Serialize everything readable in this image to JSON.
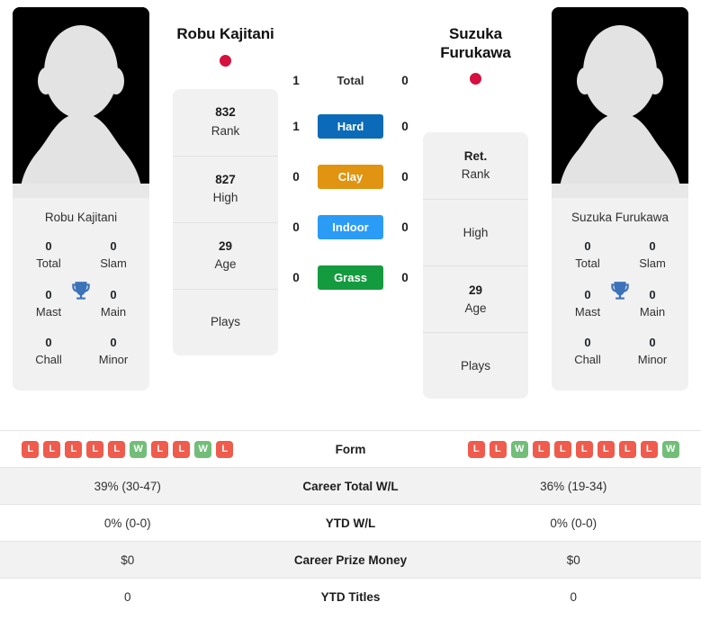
{
  "players": {
    "left": {
      "name": "Robu Kajitani",
      "card_name": "Robu Kajitani",
      "flag_color": "#d4113f",
      "titles": [
        {
          "value": "0",
          "label": "Total"
        },
        {
          "value": "0",
          "label": "Slam"
        },
        {
          "value": "0",
          "label": "Mast"
        },
        {
          "value": "0",
          "label": "Main"
        },
        {
          "value": "0",
          "label": "Chall"
        },
        {
          "value": "0",
          "label": "Minor"
        }
      ],
      "rank_rows": [
        {
          "value": "832",
          "label": "Rank"
        },
        {
          "value": "827",
          "label": "High"
        },
        {
          "value": "29",
          "label": "Age"
        },
        {
          "value": "",
          "label": "Plays"
        }
      ],
      "form": [
        "L",
        "L",
        "L",
        "L",
        "L",
        "W",
        "L",
        "L",
        "W",
        "L"
      ],
      "career_total_wl": "39% (30-47)",
      "ytd_wl": "0% (0-0)",
      "career_prize_money": "$0",
      "ytd_titles": "0"
    },
    "right": {
      "name": "Suzuka Furukawa",
      "card_name": "Suzuka Furukawa",
      "flag_color": "#d4113f",
      "titles": [
        {
          "value": "0",
          "label": "Total"
        },
        {
          "value": "0",
          "label": "Slam"
        },
        {
          "value": "0",
          "label": "Mast"
        },
        {
          "value": "0",
          "label": "Main"
        },
        {
          "value": "0",
          "label": "Chall"
        },
        {
          "value": "0",
          "label": "Minor"
        }
      ],
      "rank_rows": [
        {
          "value": "Ret.",
          "label": "Rank"
        },
        {
          "value": "",
          "label": "High"
        },
        {
          "value": "29",
          "label": "Age"
        },
        {
          "value": "",
          "label": "Plays"
        }
      ],
      "form": [
        "L",
        "L",
        "W",
        "L",
        "L",
        "L",
        "L",
        "L",
        "L",
        "W"
      ],
      "career_total_wl": "36% (19-34)",
      "ytd_wl": "0% (0-0)",
      "career_prize_money": "$0",
      "ytd_titles": "0"
    }
  },
  "head_to_head": [
    {
      "label": "Total",
      "type": "text",
      "left": "1",
      "right": "0",
      "color": ""
    },
    {
      "label": "Hard",
      "type": "badge",
      "left": "1",
      "right": "0",
      "color": "#0b6bb8"
    },
    {
      "label": "Clay",
      "type": "badge",
      "left": "0",
      "right": "0",
      "color": "#e09411"
    },
    {
      "label": "Indoor",
      "type": "badge",
      "left": "0",
      "right": "0",
      "color": "#2b9cf5"
    },
    {
      "label": "Grass",
      "type": "badge",
      "left": "0",
      "right": "0",
      "color": "#159b3f"
    }
  ],
  "stats_rows": [
    {
      "label": "Form",
      "key": "form"
    },
    {
      "label": "Career Total W/L",
      "key": "career_total_wl"
    },
    {
      "label": "YTD W/L",
      "key": "ytd_wl"
    },
    {
      "label": "Career Prize Money",
      "key": "career_prize_money"
    },
    {
      "label": "YTD Titles",
      "key": "ytd_titles"
    }
  ],
  "colors": {
    "win_badge": "#72be79",
    "loss_badge": "#ef5b4c",
    "trophy": "#3b72b8"
  }
}
